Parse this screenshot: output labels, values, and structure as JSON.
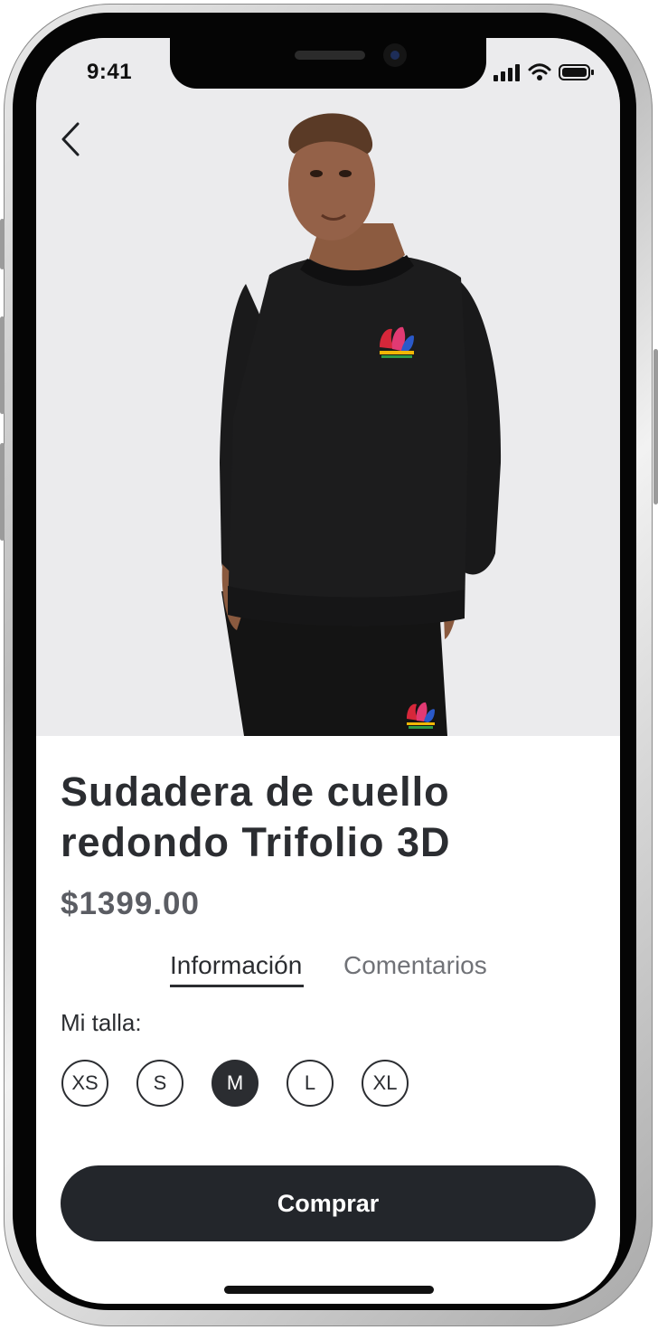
{
  "status_bar": {
    "time": "9:41",
    "icons": [
      "signal-icon",
      "wifi-icon",
      "battery-icon"
    ]
  },
  "nav": {
    "back_icon": "chevron-left-icon"
  },
  "product": {
    "title_line1": "Sudadera de cuello",
    "title_line2": "redondo Trifolio 3D",
    "price": "$1399.00"
  },
  "tabs": [
    {
      "label": "Información",
      "active": true
    },
    {
      "label": "Comentarios",
      "active": false
    }
  ],
  "size_section": {
    "label": "Mi talla:",
    "options": [
      "XS",
      "S",
      "M",
      "L",
      "XL"
    ],
    "selected": "M"
  },
  "buy_button": {
    "label": "Comprar"
  },
  "colors": {
    "primary": "#23262b",
    "hero_bg": "#ebebed",
    "text": "#2b2d31",
    "muted": "#707277"
  }
}
